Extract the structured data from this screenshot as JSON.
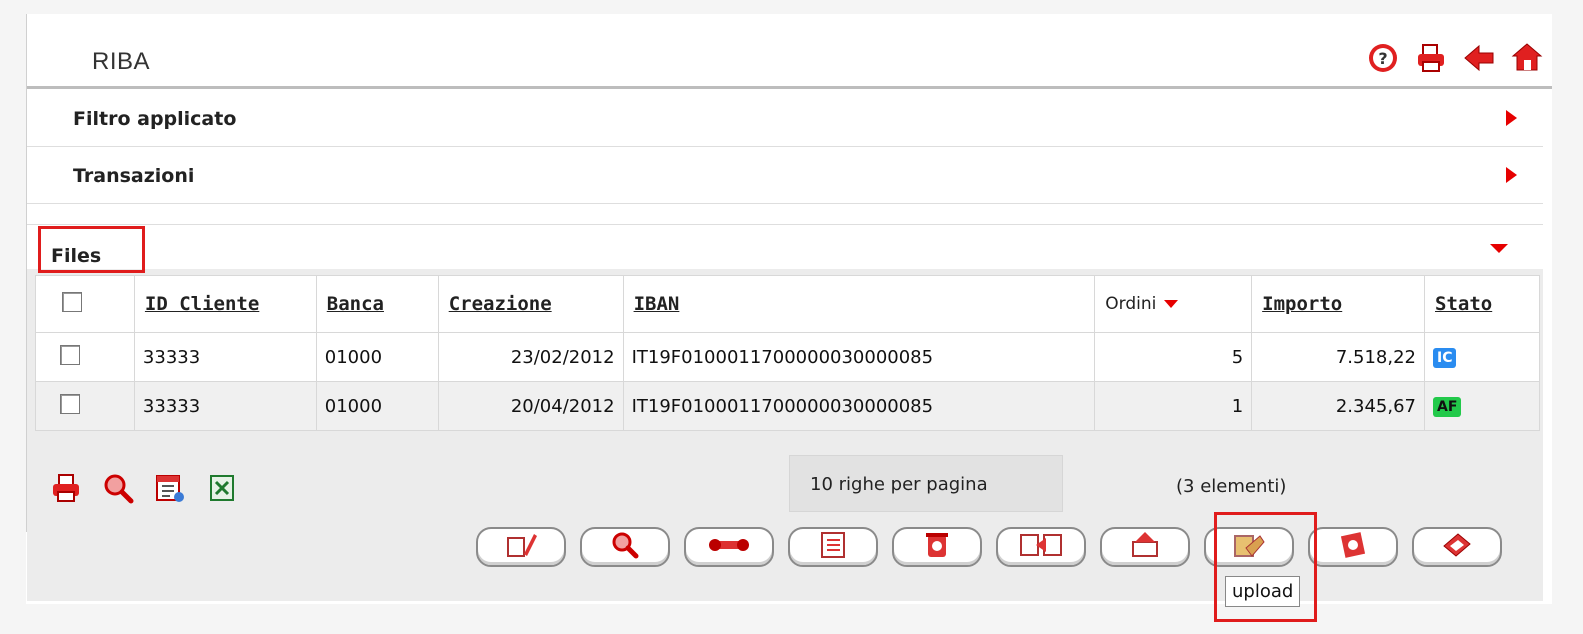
{
  "app": {
    "title": "RIBA"
  },
  "top_icons": [
    "help-icon",
    "print-icon",
    "back-icon",
    "home-icon"
  ],
  "sections": [
    {
      "label": "Filtro applicato"
    },
    {
      "label": "Transazioni"
    }
  ],
  "files": {
    "label": "Files",
    "columns": [
      "ID Cliente",
      "Banca",
      "Creazione",
      "IBAN",
      "Ordini",
      "Importo",
      "Stato"
    ],
    "rows": [
      {
        "id_cliente": "33333",
        "banca": "01000",
        "creazione": "23/02/2012",
        "iban": "IT19F0100011700000030000085",
        "ordini": "5",
        "importo": "7.518,22",
        "stato": "IC",
        "stato_color": "#2a8cf0"
      },
      {
        "id_cliente": "33333",
        "banca": "01000",
        "creazione": "20/04/2012",
        "iban": "IT19F0100011700000030000085",
        "ordini": "1",
        "importo": "2.345,67",
        "stato": "AF",
        "stato_color": "#22c94a"
      }
    ]
  },
  "bottom_icons": [
    "print-icon",
    "zoom-icon",
    "calendar-icon",
    "excel-icon"
  ],
  "pager": {
    "rows_per_page": "10 righe per pagina",
    "count": "(3 elementi)"
  },
  "action_buttons": [
    "edit-icon",
    "search-icon",
    "tools-icon",
    "list-icon",
    "trash-icon",
    "transfer-icon",
    "send-icon",
    "upload-icon",
    "document-icon",
    "export-icon"
  ],
  "tooltip": "upload",
  "colors": {
    "accent": "#e60000",
    "highlight": "#e01c1c"
  }
}
